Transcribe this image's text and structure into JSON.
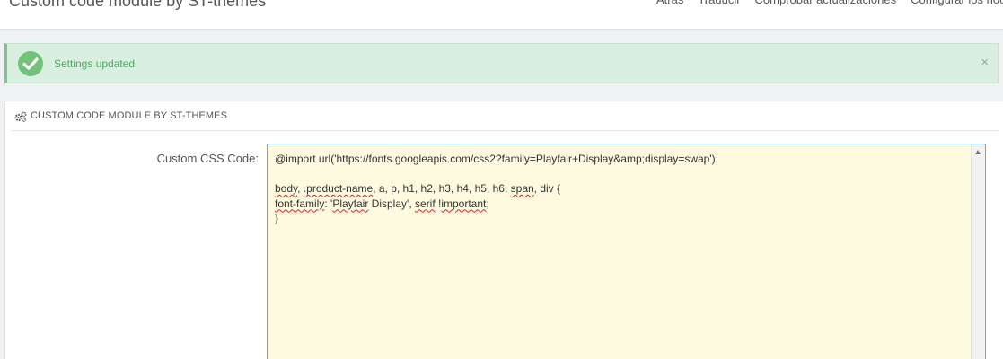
{
  "header": {
    "title": "Custom code module by ST-themes",
    "toolbar": [
      "Atrás",
      "Traducir",
      "Comprobar actualizaciones",
      "Configurar los hooks"
    ]
  },
  "alert": {
    "message": "Settings updated",
    "close_glyph": "×",
    "color": "#72c279"
  },
  "panel": {
    "title": "CUSTOM CODE MODULE BY ST-THEMES",
    "icon": "gears-icon"
  },
  "form": {
    "css_label": "Custom CSS Code:",
    "css_lines": [
      [
        {
          "t": "@import url('https://fonts.googleapis.com/css2?family=Playfair+Display&amp;display=swap');",
          "s": false
        }
      ],
      [
        {
          "t": "",
          "s": false
        }
      ],
      [
        {
          "t": "body",
          "s": true
        },
        {
          "t": ", ",
          "s": false
        },
        {
          "t": ".product-name",
          "s": true
        },
        {
          "t": ", a, p, h1, h2, h3, h4, h5, h6, ",
          "s": false
        },
        {
          "t": "span",
          "s": true
        },
        {
          "t": ", div {",
          "s": false
        }
      ],
      [
        {
          "t": "font-family",
          "s": true
        },
        {
          "t": ": '",
          "s": false
        },
        {
          "t": "Playfair",
          "s": true
        },
        {
          "t": " Display', ",
          "s": false
        },
        {
          "t": "serif",
          "s": true
        },
        {
          "t": " !",
          "s": false
        },
        {
          "t": "important",
          "s": true
        },
        {
          "t": ";",
          "s": false
        }
      ],
      [
        {
          "t": "}",
          "s": false
        }
      ]
    ]
  }
}
